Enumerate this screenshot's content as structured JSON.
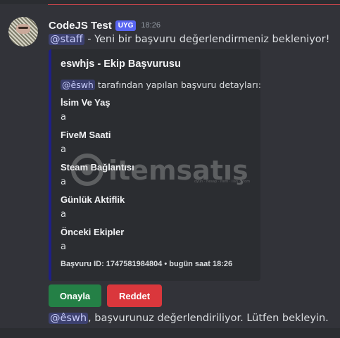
{
  "message": {
    "author": "CodeJS Test",
    "badge": "UYG",
    "time": "18:26",
    "content_mention": "@staff",
    "content_text": " - Yeni bir başvuru değerlendirmeniz bekleniyor!"
  },
  "embed": {
    "title": "eswhjs - Ekip Başvurusu",
    "desc_mention": "@êswh",
    "desc_text": " tarafından yapılan başvuru detayları:",
    "fields": [
      {
        "name": "İsim Ve Yaş",
        "value": "a"
      },
      {
        "name": "FiveM Saati",
        "value": "a"
      },
      {
        "name": "Steam Bağlantısı",
        "value": "a"
      },
      {
        "name": "Günlük Aktiflik",
        "value": "a"
      },
      {
        "name": "Önceki Ekipler",
        "value": "a"
      }
    ],
    "footer": "Başvuru ID: 1747581984804 • bugün saat 18:26",
    "accent_color": "#1e1f85"
  },
  "buttons": {
    "approve": "Onayla",
    "reject": "Reddet"
  },
  "followup": {
    "mention": "@êswh",
    "text": ", başvurunuz değerlendiriliyor. Lütfen bekleyin."
  },
  "watermark": {
    "text": "itemsatış",
    "subtext": "oyun · hesap · item · ilan · .com"
  },
  "colors": {
    "background": "#323339",
    "approve": "#248046",
    "reject": "#da373c",
    "badge": "#5865f2",
    "mention_bg": "#3c4270"
  }
}
